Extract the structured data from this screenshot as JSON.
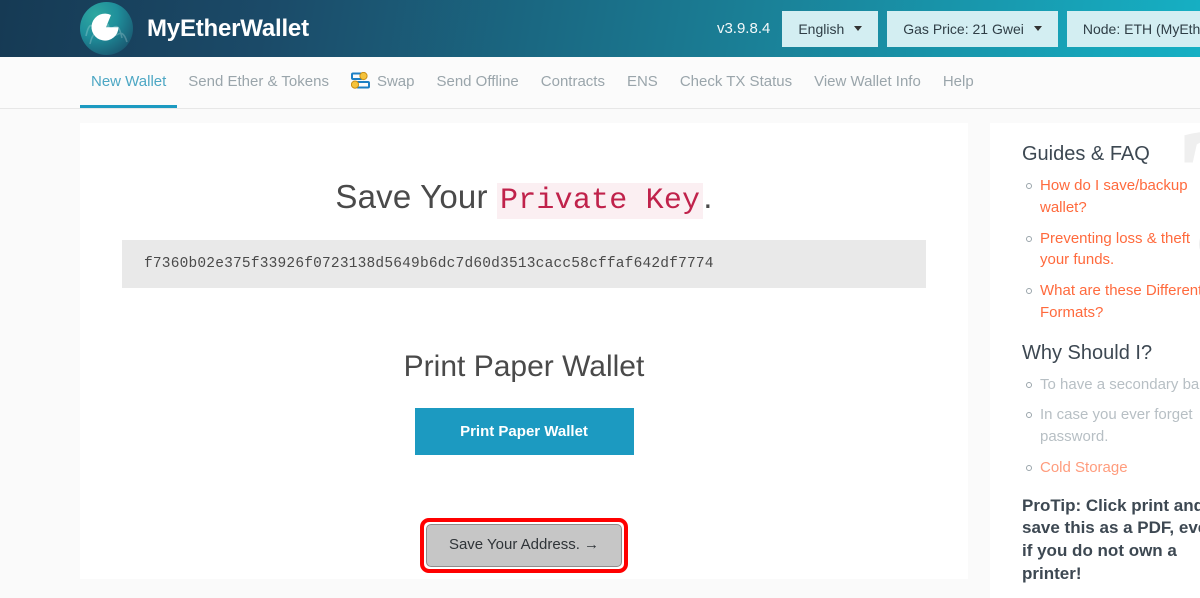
{
  "header": {
    "brand": "MyEtherWallet",
    "logo_icon": "mew-logo-icon",
    "version": "v3.9.8.4",
    "language_label": "English",
    "gas_price_label": "Gas Price: 21 Gwei",
    "node_label": "Node: ETH (MyEtherW",
    "accent_gradient_start": "#163a54",
    "accent_gradient_end": "#16b0c4",
    "button_bg": "#d3eef2"
  },
  "nav": {
    "items": [
      {
        "label": "New Wallet",
        "active": true,
        "icon": ""
      },
      {
        "label": "Send Ether & Tokens",
        "active": false,
        "icon": ""
      },
      {
        "label": "Swap",
        "active": false,
        "icon": "swap-icon"
      },
      {
        "label": "Send Offline",
        "active": false,
        "icon": ""
      },
      {
        "label": "Contracts",
        "active": false,
        "icon": ""
      },
      {
        "label": "ENS",
        "active": false,
        "icon": ""
      },
      {
        "label": "Check TX Status",
        "active": false,
        "icon": ""
      },
      {
        "label": "View Wallet Info",
        "active": false,
        "icon": ""
      },
      {
        "label": "Help",
        "active": false,
        "icon": ""
      }
    ],
    "active_color": "#4da7c4",
    "active_underline": "#1c9ac1"
  },
  "main": {
    "title_prefix": "Save Your ",
    "title_highlight": "Private Key",
    "title_suffix": ".",
    "private_key": "f7360b02e375f33926f0723138d5649b6dc7d60d3513cacc58cffaf642df7774",
    "subtitle": "Print Paper Wallet",
    "print_button": "Print Paper Wallet",
    "address_button": "Save Your Address. →",
    "highlight_color": "#ff0000",
    "print_button_color": "#1c9ac1",
    "key_highlight_color": "#c0224b"
  },
  "sidebar": {
    "watermark_glyph": "?",
    "guides_heading": "Guides & FAQ",
    "guides_items": [
      "How do I save/backup wallet?",
      "Preventing loss & theft your funds.",
      "What are these Different Formats?"
    ],
    "why_heading": "Why Should I?",
    "why_items": [
      {
        "text": "To have a secondary ba",
        "link": false
      },
      {
        "text": "In case you ever forget password.",
        "link": false
      },
      {
        "text": "Cold Storage",
        "link": true
      }
    ],
    "protip": "ProTip: Click print and save this as a PDF, even if you do not own a printer!",
    "link_color": "#ff6a3d"
  }
}
